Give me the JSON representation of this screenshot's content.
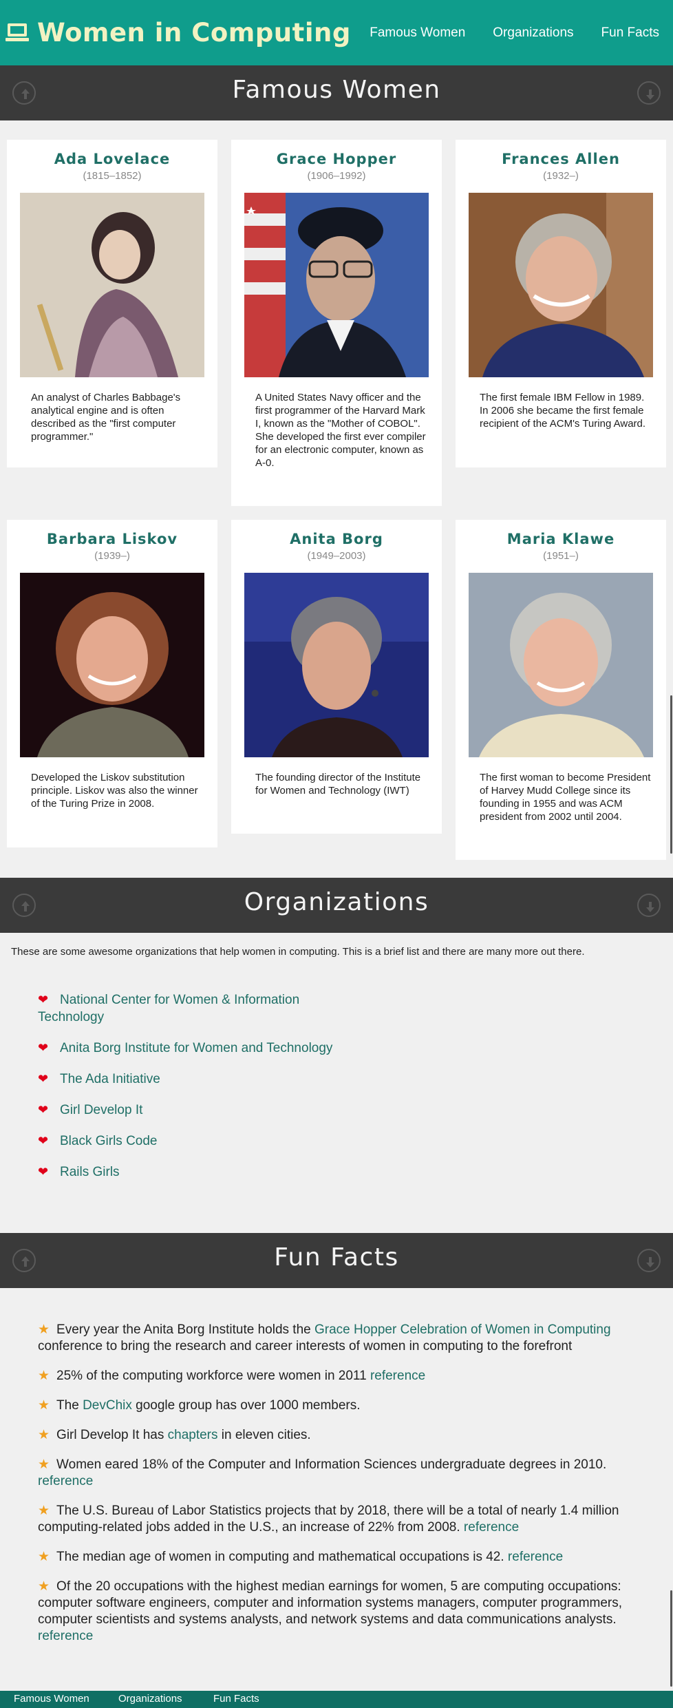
{
  "header": {
    "title": "Women in Computing",
    "nav": [
      "Famous Women",
      "Organizations",
      "Fun Facts"
    ]
  },
  "famous": {
    "title": "Famous Women",
    "people": [
      {
        "name": "Ada Lovelace",
        "years": "(1815–1852)",
        "desc": "An analyst of Charles Babbage's analytical engine and is often described as the \"first computer programmer.\""
      },
      {
        "name": "Grace Hopper",
        "years": "(1906–1992)",
        "desc": "A United States Navy officer and the first programmer of the Harvard Mark I, known as the \"Mother of COBOL\". She developed the first ever compiler for an electronic computer, known as A-0."
      },
      {
        "name": "Frances Allen",
        "years": "(1932–)",
        "desc": "The first female IBM Fellow in 1989. In 2006 she became the first female recipient of the ACM's Turing Award."
      },
      {
        "name": "Barbara Liskov",
        "years": "(1939–)",
        "desc": "Developed the Liskov substitution principle. Liskov was also the winner of the Turing Prize in 2008."
      },
      {
        "name": "Anita Borg",
        "years": "(1949–2003)",
        "desc": "The founding director of the Institute for Women and Technology (IWT)"
      },
      {
        "name": "Maria Klawe",
        "years": "(1951–)",
        "desc": "The first woman to become President of Harvey Mudd College since its founding in 1955 and was ACM president from 2002 until 2004."
      }
    ]
  },
  "orgs": {
    "title": "Organizations",
    "intro": "These are some awesome organizations that help women in computing. This is a brief list and there are many more out there.",
    "items": [
      "National Center for Women & Information Technology",
      "Anita Borg Institute for Women and Technology",
      "The Ada Initiative",
      "Girl Develop It",
      "Black Girls Code",
      "Rails Girls"
    ]
  },
  "facts": {
    "title": "Fun Facts",
    "items": [
      {
        "pre": "Every year the Anita Borg Institute holds the ",
        "link": "Grace Hopper Celebration of Women in Computing",
        "post": " conference to bring the research and career interests of women in computing to the forefront"
      },
      {
        "pre": "25% of the computing workforce were women in 2011 ",
        "link": "reference",
        "post": ""
      },
      {
        "pre": "The ",
        "link": "DevChix",
        "post": " google group has over 1000 members."
      },
      {
        "pre": "Girl Develop It has ",
        "link": "chapters",
        "post": " in eleven cities."
      },
      {
        "pre": "Women eared 18% of the Computer and Information Sciences undergraduate degrees in 2010. ",
        "link": "reference",
        "post": ""
      },
      {
        "pre": "The U.S. Bureau of Labor Statistics projects that by 2018, there will be a total of nearly 1.4 million computing-related jobs added in the U.S., an increase of 22% from 2008. ",
        "link": "reference",
        "post": ""
      },
      {
        "pre": "The median age of women in computing and mathematical occupations is 42. ",
        "link": "reference",
        "post": ""
      },
      {
        "pre": "Of the 20 occupations with the highest median earnings for women, 5 are computing occupations: computer software engineers, computer and information systems managers, computer programmers, computer scientists and systems analysts, and network systems and data communications analysts. ",
        "link": "reference",
        "post": ""
      }
    ]
  },
  "footer": {
    "nav": [
      "Famous Women",
      "Organizations",
      "Fun Facts"
    ]
  },
  "colors": {
    "header_bg": "#0f9d8c",
    "section_bar": "#3a3a3a",
    "accent_text": "#1f6f66",
    "heart": "#e0001a",
    "star": "#f0a020",
    "footer_bg": "#0f6f64"
  },
  "icons": [
    "laptop-icon",
    "up-arrow-circle-icon",
    "down-arrow-circle-icon",
    "heart-icon",
    "star-icon"
  ]
}
